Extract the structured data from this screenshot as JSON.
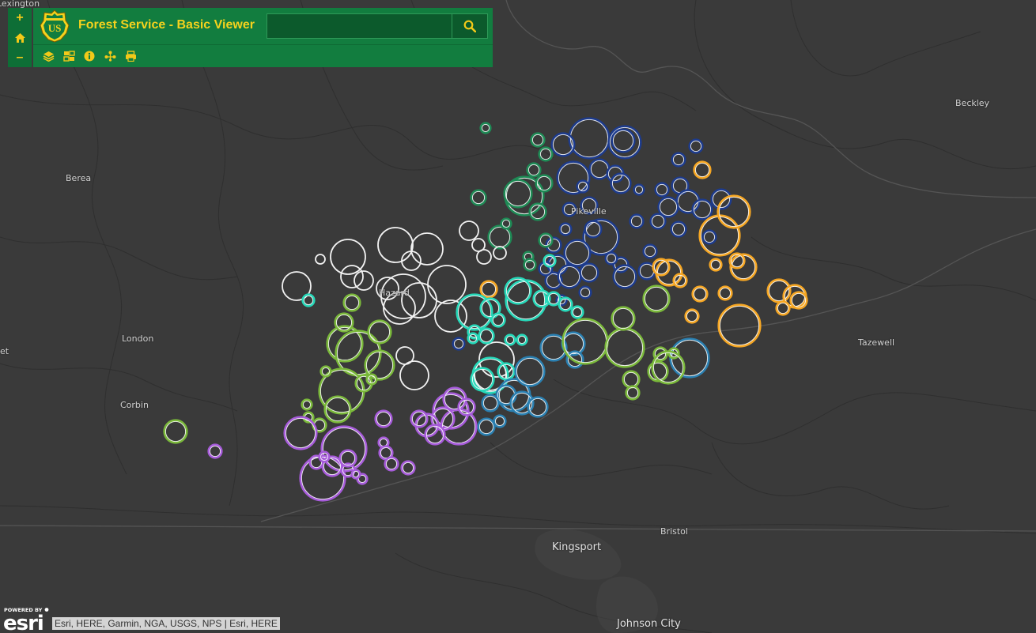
{
  "app": {
    "title": "Forest Service - Basic Viewer",
    "logo_text": "US"
  },
  "colors": {
    "header": "#127d3f",
    "accent": "#f5d21d",
    "map_bg": "#3a3a3a"
  },
  "search": {
    "value": "",
    "placeholder": ""
  },
  "zoom": {
    "in_label": "+",
    "home_icon": "home-icon",
    "out_label": "–"
  },
  "toolbar": [
    "layers-icon",
    "basemap-gallery-icon",
    "info-icon",
    "share-icon",
    "print-icon"
  ],
  "places": [
    {
      "name": "Lexington",
      "big": false
    },
    {
      "name": "Beckley",
      "big": false
    },
    {
      "name": "Berea",
      "big": false
    },
    {
      "name": "Pikeville",
      "big": false
    },
    {
      "name": "Hazard",
      "big": false
    },
    {
      "name": "London",
      "big": false
    },
    {
      "name": "Tazewell",
      "big": false
    },
    {
      "name": "Corbin",
      "big": false
    },
    {
      "name": "Bristol",
      "big": false
    },
    {
      "name": "Kingsport",
      "big": true
    },
    {
      "name": "Johnson City",
      "big": true
    },
    {
      "name": "et",
      "big": false
    }
  ],
  "attribution": {
    "powered_by": "POWERED BY",
    "brand": "esri",
    "text": "Esri, HERE, Garmin, NGA, USGS, NPS | Esri, HERE"
  },
  "symbol_colors": {
    "navy": "#1d3b8c",
    "green": "#1e8a55",
    "white": "#f2f2f2",
    "teal": "#26d7b8",
    "lightgreen": "#7ab83a",
    "purple": "#a65bd9",
    "blue": "#2a7fb0",
    "orange": "#f5a623"
  }
}
